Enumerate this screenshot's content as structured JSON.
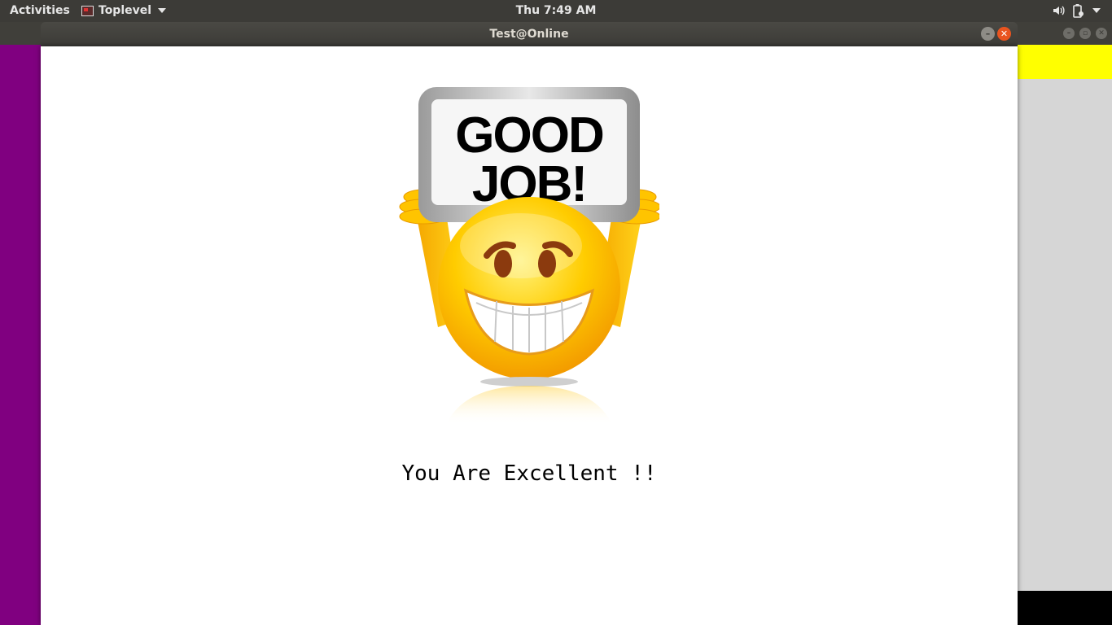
{
  "topbar": {
    "activities": "Activities",
    "app_menu": "Toplevel",
    "clock": "Thu  7:49 AM"
  },
  "window": {
    "title": "Test@Online",
    "sign_text_line1": "GOOD",
    "sign_text_line2": "JOB!",
    "message": "You Are Excellent !!"
  },
  "colors": {
    "topbar": "#3c3b37",
    "purple_panel": "#800080",
    "yellow_strip": "#ffff00",
    "close_button": "#e9541f"
  }
}
